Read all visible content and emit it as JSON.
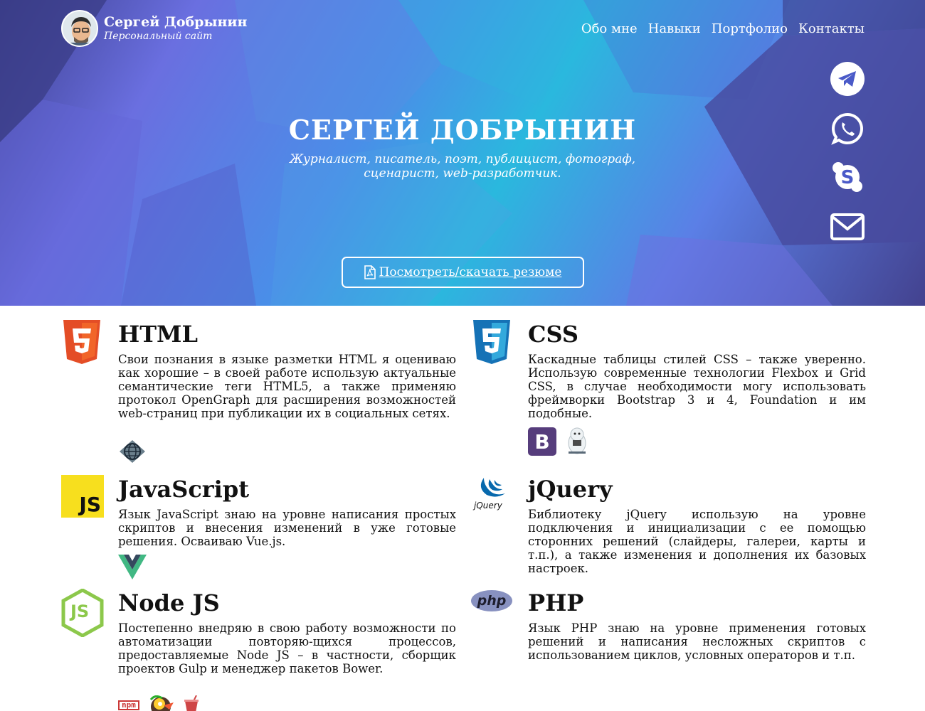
{
  "site": {
    "name": "Сергей Добрынин",
    "tagline": "Персональный сайт"
  },
  "nav": {
    "items": [
      "Обо мне",
      "Навыки",
      "Портфолио",
      "Контакты"
    ]
  },
  "social": [
    "telegram-icon",
    "whatsapp-icon",
    "skype-icon",
    "mail-icon"
  ],
  "hero": {
    "title": "СЕРГЕЙ ДОБРЫНИН",
    "subtitle_line1": "Журналист, писатель, поэт, публицист, фотограф,",
    "subtitle_line2": "сценарист, web-разработчик.",
    "resume_button": "Посмотреть/скачать резюме"
  },
  "skills": [
    {
      "title": "HTML",
      "icon": "html5-icon",
      "text": "Свои познания в языке разметки HTML я оцениваю как хорошие – в своей работе использую актуальные семантические теги HTML5, а также применяю протокол OpenGraph для расширения возможностей web-страниц при публикации их в социальных сетях.",
      "tools": [
        "opengraph-icon"
      ]
    },
    {
      "title": "CSS",
      "icon": "css3-icon",
      "text": "Каскадные таблицы стилей CSS – также уверенно. Использую современные технологии Flexbox и Grid CSS, в случае необходимости могу использовать фреймворки Bootstrap 3 и 4, Foundation и им подобные.",
      "tools": [
        "bootstrap-icon",
        "foundation-yeti-icon"
      ],
      "bootstrap_letter": "B"
    },
    {
      "title": "JavaScript",
      "icon": "javascript-icon",
      "icon_text": "JS",
      "text": "Язык JavaScript знаю на уровне написания простых скриптов и внесения изменений в уже готовые решения. Осваиваю Vue.js.",
      "tools": [
        "vuejs-icon"
      ]
    },
    {
      "title": "jQuery",
      "icon": "jquery-icon",
      "icon_text": "jQuery",
      "text": "Библиотеку jQuery использую на уровне подключения и инициализации с ее помощью сторонних решений (слайдеры, галереи, карты и т.п.), а также изменения и дополнения их базовых настроек.",
      "tools": []
    },
    {
      "title": "Node JS",
      "icon": "nodejs-icon",
      "icon_text": "JS",
      "text": "Постепенно внедряю в свою работу возможности по автоматизации повторяю-щихся процессов, предоставляемые Node JS – в частности, сборщик проектов Gulp и менеджер пакетов Bower.",
      "tools": [
        "npm-icon",
        "bower-icon",
        "gulp-icon"
      ],
      "npm_text": "npm"
    },
    {
      "title": "PHP",
      "icon": "php-icon",
      "icon_text": "php",
      "text": "Язык PHP знаю на уровне применения готовых решений и написания несложных скриптов с использованием циклов, условных операторов и т.п.",
      "tools": []
    }
  ],
  "colors": {
    "html5": "#e44d26",
    "css3": "#1572b6",
    "js": "#f7df1e",
    "jquery": "#0769ad",
    "node": "#8cc84b",
    "php": "#777bb3",
    "bootstrap": "#563d7c",
    "vue": "#41b883",
    "npm": "#cb3837"
  }
}
